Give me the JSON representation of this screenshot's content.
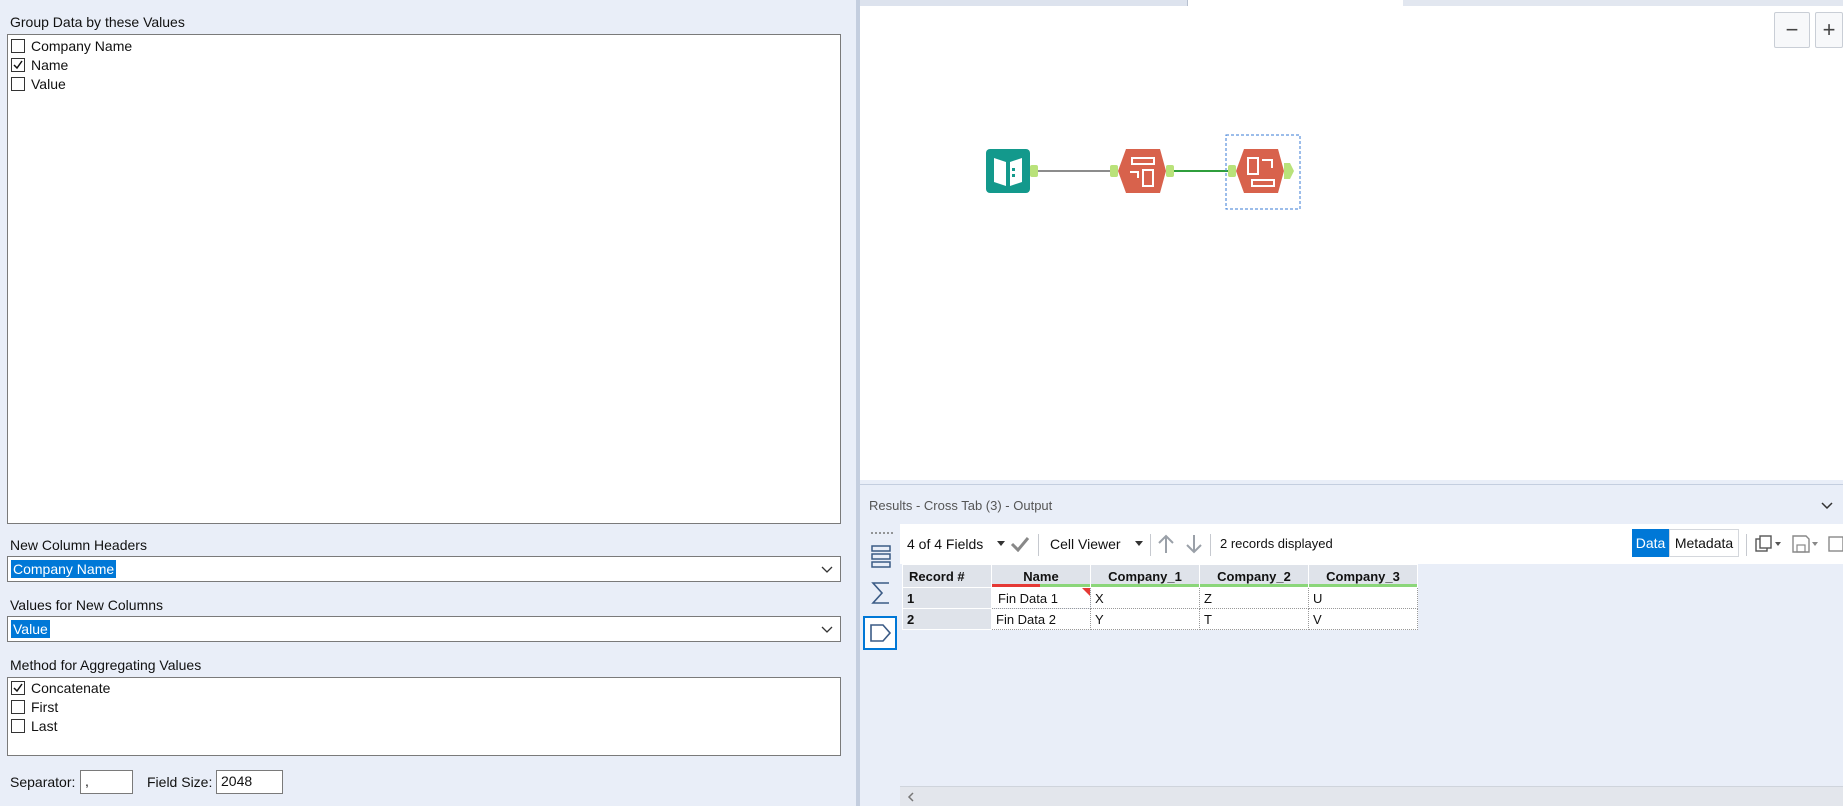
{
  "config": {
    "group_label": "Group Data by these Values",
    "group_options": [
      {
        "label": "Company Name",
        "checked": false
      },
      {
        "label": "Name",
        "checked": true
      },
      {
        "label": "Value",
        "checked": false
      }
    ],
    "headers_label": "New Column Headers",
    "headers_value": "Company Name",
    "values_label": "Values for New Columns",
    "values_value": "Value",
    "method_label": "Method for Aggregating Values",
    "method_options": [
      {
        "label": "Concatenate",
        "checked": true
      },
      {
        "label": "First",
        "checked": false
      },
      {
        "label": "Last",
        "checked": false
      }
    ],
    "separator_label": "Separator:",
    "separator_value": ",",
    "fieldsize_label": "Field Size:",
    "fieldsize_value": "2048"
  },
  "canvas": {
    "zoom_out": "−",
    "zoom_in": "+",
    "tools": [
      "input-data-tool-icon",
      "cross-tab-tool-icon",
      "cross-tab-selected-tool-icon"
    ],
    "colors": {
      "input": "#13998c",
      "tool": "#d8624c",
      "anchor": "#b9e27a",
      "selection": "#3a7bd5"
    }
  },
  "results": {
    "title": "Results - Cross Tab (3) - Output",
    "fields": "4 of 4 Fields",
    "cell_viewer": "Cell Viewer",
    "records": "2 records displayed",
    "data_btn": "Data",
    "metadata_btn": "Metadata",
    "columns": [
      "Record #",
      "Name",
      "Company_1",
      "Company_2",
      "Company_3"
    ],
    "rows": [
      [
        "1",
        "Fin Data 1",
        "X",
        "Z",
        "U"
      ],
      [
        "2",
        "Fin Data 2",
        "Y",
        "T",
        "V"
      ]
    ]
  }
}
